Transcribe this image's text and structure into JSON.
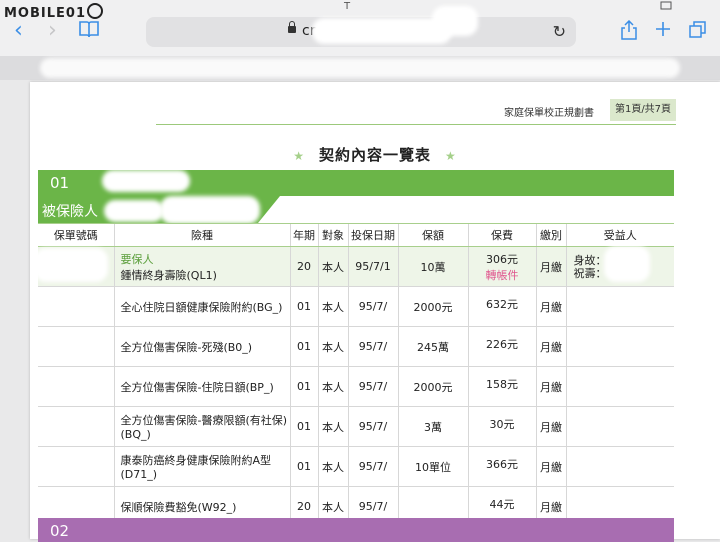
{
  "watermark": "MOBILE01",
  "statusbar": {
    "top_char": "T"
  },
  "browser": {
    "url": "cr",
    "nav": {
      "back": "‹",
      "forward": "›"
    }
  },
  "doc": {
    "doc_name": "家庭保單校正規劃書",
    "page_indicator": "第1頁/共7頁",
    "title": "契約內容一覽表",
    "section_number": "01",
    "insured_label": "被保險人",
    "section2_number": "02",
    "columns": [
      "保單號碼",
      "險種",
      "年期",
      "對象",
      "投保日期",
      "保額",
      "保費",
      "繳別",
      "受益人"
    ],
    "rows": [
      {
        "role": "要保人",
        "name": "鍾情終身壽險(QL1)",
        "term": "20",
        "target": "本人",
        "date": "95/7/1",
        "amount": "10萬",
        "fee": "306元",
        "fee_note": "轉帳件",
        "pay": "月繳",
        "beneficiary": [
          "身故：",
          "祝壽："
        ]
      },
      {
        "name": "全心住院日額健康保險附約(BG_)",
        "term": "01",
        "target": "本人",
        "date": "95/7/",
        "amount": "2000元",
        "fee": "632元",
        "pay": "月繳"
      },
      {
        "name": "全方位傷害保險-死殘(B0_)",
        "term": "01",
        "target": "本人",
        "date": "95/7/",
        "amount": "245萬",
        "fee": "226元",
        "pay": "月繳"
      },
      {
        "name": "全方位傷害保險-住院日額(BP_)",
        "term": "01",
        "target": "本人",
        "date": "95/7/",
        "amount": "2000元",
        "fee": "158元",
        "pay": "月繳"
      },
      {
        "name": "全方位傷害保險-醫療限額(有社保)(BQ_)",
        "term": "01",
        "target": "本人",
        "date": "95/7/",
        "amount": "3萬",
        "fee": "30元",
        "pay": "月繳"
      },
      {
        "name": "康泰防癌終身健康保險附約A型(D71_)",
        "term": "01",
        "target": "本人",
        "date": "95/7/",
        "amount": "10單位",
        "fee": "366元",
        "pay": "月繳"
      },
      {
        "name": "保順保險費豁免(W92_)",
        "term": "20",
        "target": "本人",
        "date": "95/7/",
        "amount": "",
        "fee": "44元",
        "pay": "月繳"
      }
    ]
  }
}
